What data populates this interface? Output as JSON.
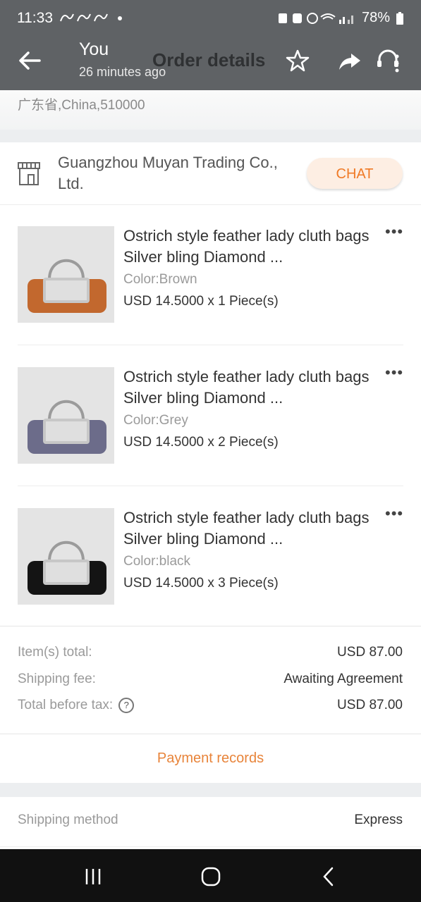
{
  "status": {
    "time": "11:33",
    "battery": "78%"
  },
  "header": {
    "sender": "You",
    "time_ago": "26 minutes ago",
    "title": "Order details"
  },
  "address": {
    "tail": "广东省,China,510000"
  },
  "seller": {
    "name": "Guangzhou Muyan Trading Co., Ltd.",
    "chat_label": "CHAT"
  },
  "items": [
    {
      "title": "Ostrich style feather lady cluth bags Silver bling Diamond ...",
      "color": "Color:Brown",
      "price": "USD 14.5000 x 1 Piece(s)",
      "feather_color": "#c2682e"
    },
    {
      "title": "Ostrich style feather lady cluth bags Silver bling Diamond ...",
      "color": "Color:Grey",
      "price": "USD 14.5000 x 2 Piece(s)",
      "feather_color": "#6c6c8a"
    },
    {
      "title": "Ostrich style feather lady cluth bags Silver bling Diamond ...",
      "color": "Color:black",
      "price": "USD 14.5000 x 3 Piece(s)",
      "feather_color": "#141414"
    }
  ],
  "totals": {
    "items_label": "Item(s) total:",
    "items_value": "USD 87.00",
    "shipping_label": "Shipping fee:",
    "shipping_value": "Awaiting Agreement",
    "before_tax_label": "Total before tax:",
    "before_tax_value": "USD 87.00"
  },
  "payment_records": "Payment records",
  "shipping": {
    "label": "Shipping method",
    "value": "Express"
  },
  "colors": {
    "accent": "#f07a26",
    "appbar": "#5f6265"
  }
}
